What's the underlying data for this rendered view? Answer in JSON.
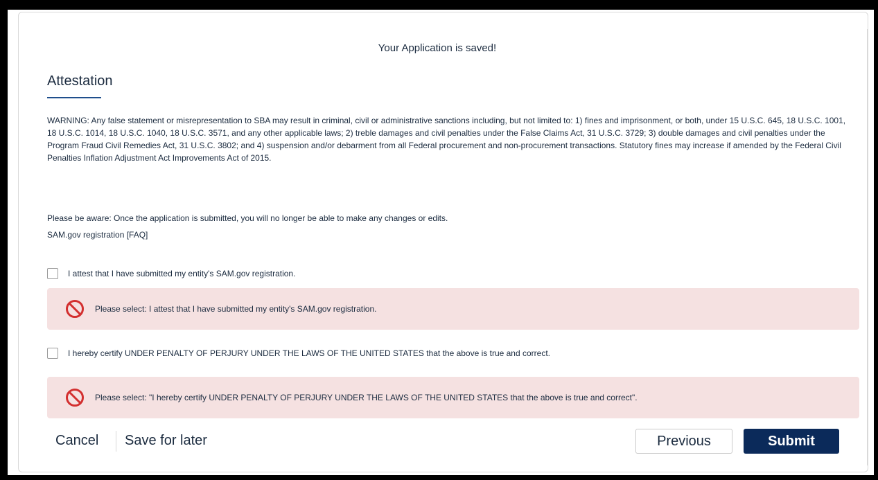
{
  "status_message": "Your Application is saved!",
  "section_title": "Attestation",
  "warning_text": "WARNING: Any false statement or misrepresentation to SBA may result in criminal, civil or administrative sanctions including, but not limited to: 1) fines and imprisonment, or both, under 15 U.S.C. 645, 18 U.S.C. 1001, 18 U.S.C. 1014, 18 U.S.C. 1040, 18 U.S.C. 3571, and any other applicable laws; 2) treble damages and civil penalties under the False Claims Act, 31 U.S.C. 3729; 3) double damages and civil penalties under the Program Fraud Civil Remedies Act, 31 U.S.C. 3802; and 4) suspension and/or debarment from all Federal procurement and non-procurement transactions. Statutory fines may increase if amended by the Federal Civil Penalties Inflation Adjustment Act Improvements Act of 2015.",
  "aware_text": "Please be aware: Once the application is submitted, you will no longer be able to make any changes or edits.",
  "faq_link": "SAM.gov registration [FAQ]",
  "attestations": [
    {
      "label": "I attest that I have submitted my entity's SAM.gov registration.",
      "checked": false,
      "error": "Please select: I attest that I have submitted my entity's SAM.gov registration."
    },
    {
      "label": "I hereby certify UNDER PENALTY OF PERJURY UNDER THE LAWS OF THE UNITED STATES that the above is true and correct.",
      "checked": false,
      "error": "Please select: \"I hereby certify UNDER PENALTY OF PERJURY UNDER THE LAWS OF THE UNITED STATES that the above is true and correct\"."
    }
  ],
  "footer": {
    "cancel": "Cancel",
    "save_later": "Save for later",
    "previous": "Previous",
    "submit": "Submit"
  },
  "icons": {
    "error": "prohibited-icon"
  },
  "colors": {
    "error_bg": "#f5e1e1",
    "error_icon": "#d32f2f",
    "primary": "#0b2a5a",
    "heading_accent": "#1f4e8c"
  }
}
